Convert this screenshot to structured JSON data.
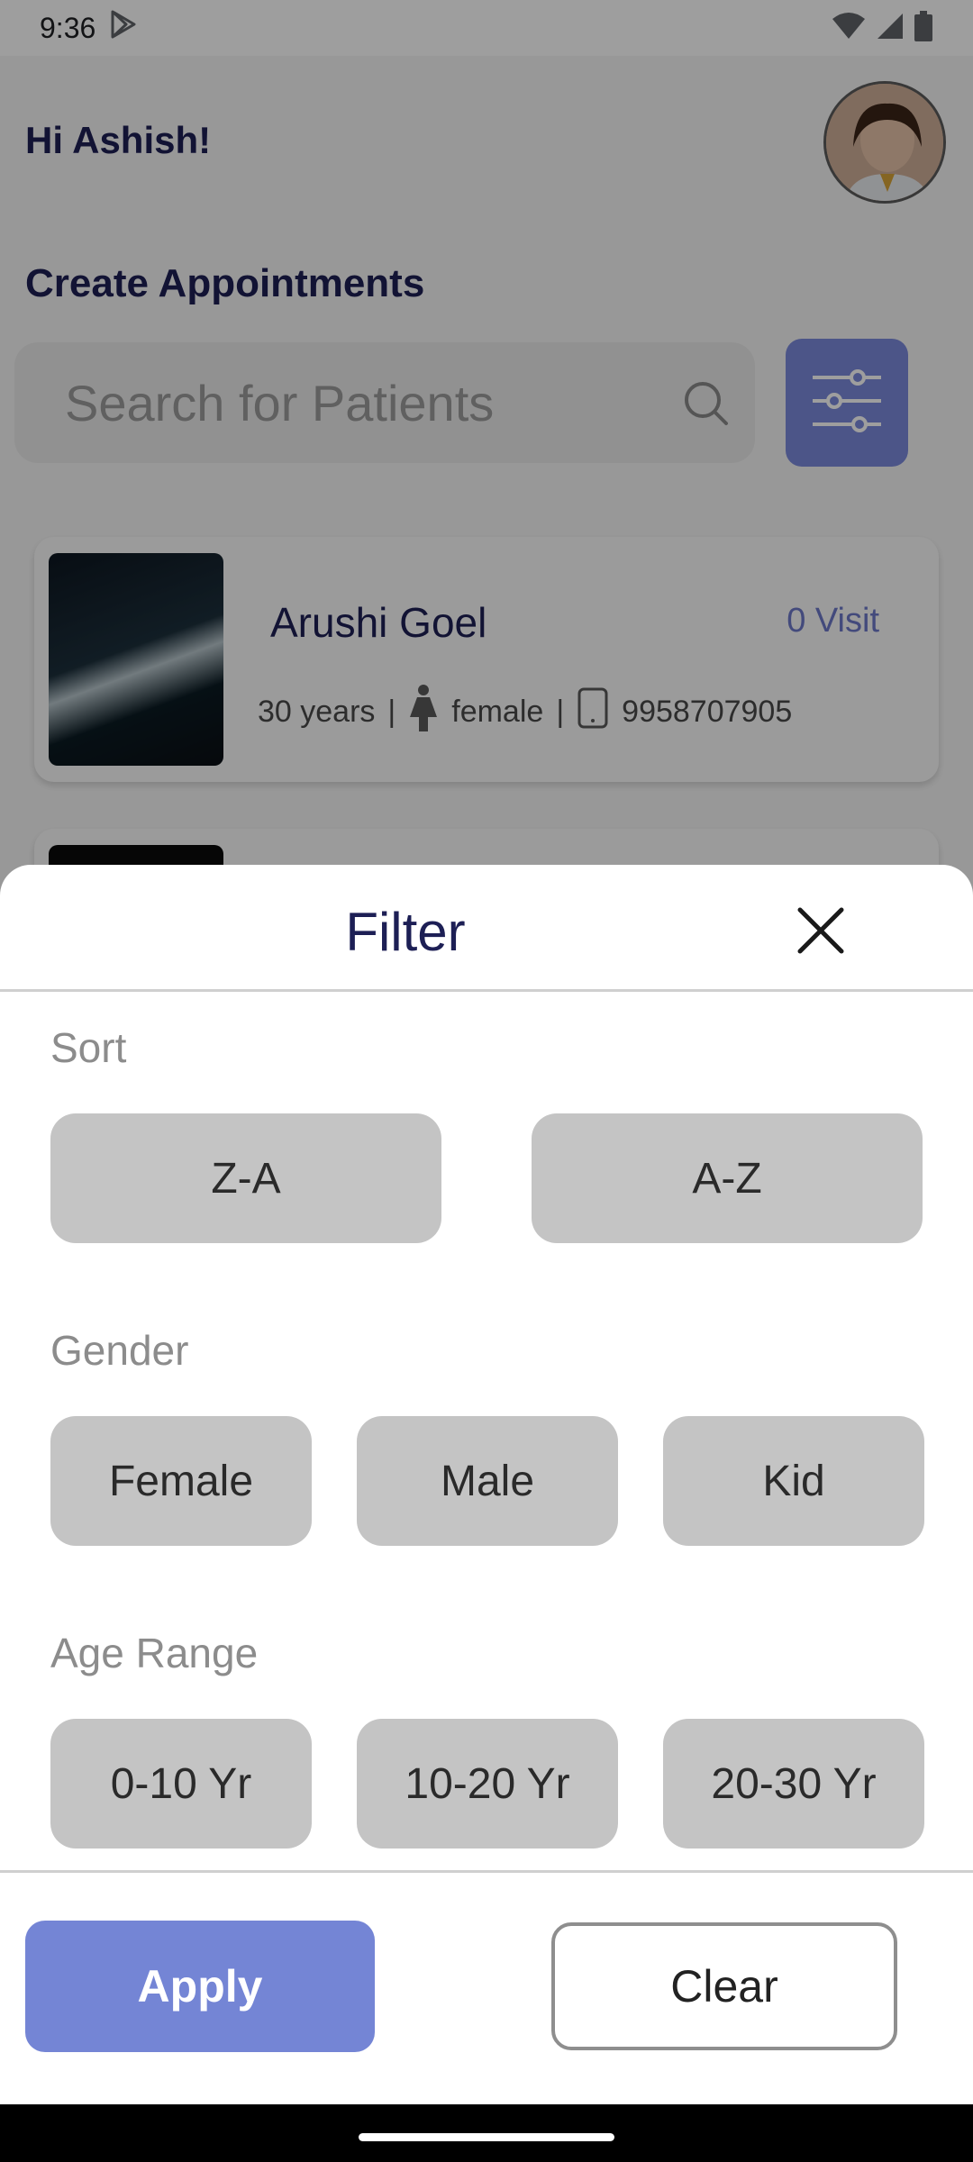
{
  "status_bar": {
    "time": "9:36"
  },
  "app": {
    "greeting": "Hi Ashish!",
    "section_title": "Create Appointments",
    "search_placeholder": "Search for Patients",
    "patients": [
      {
        "name": "Arushi  Goel",
        "visits": "0 Visit",
        "age": "30 years",
        "gender": "female",
        "phone": "9958707905"
      }
    ]
  },
  "filter": {
    "title": "Filter",
    "sort_label": "Sort",
    "sort_options": [
      "Z-A",
      "A-Z"
    ],
    "gender_label": "Gender",
    "gender_options": [
      "Female",
      "Male",
      "Kid"
    ],
    "age_label": "Age Range",
    "age_options": [
      "0-10 Yr",
      "10-20 Yr",
      "20-30 Yr"
    ],
    "apply_label": "Apply",
    "clear_label": "Clear"
  },
  "colors": {
    "primary": "#7485d5",
    "title_text": "#1d1f55",
    "option_bg": "#c4c4c4",
    "visit_text": "#6d78c8"
  }
}
